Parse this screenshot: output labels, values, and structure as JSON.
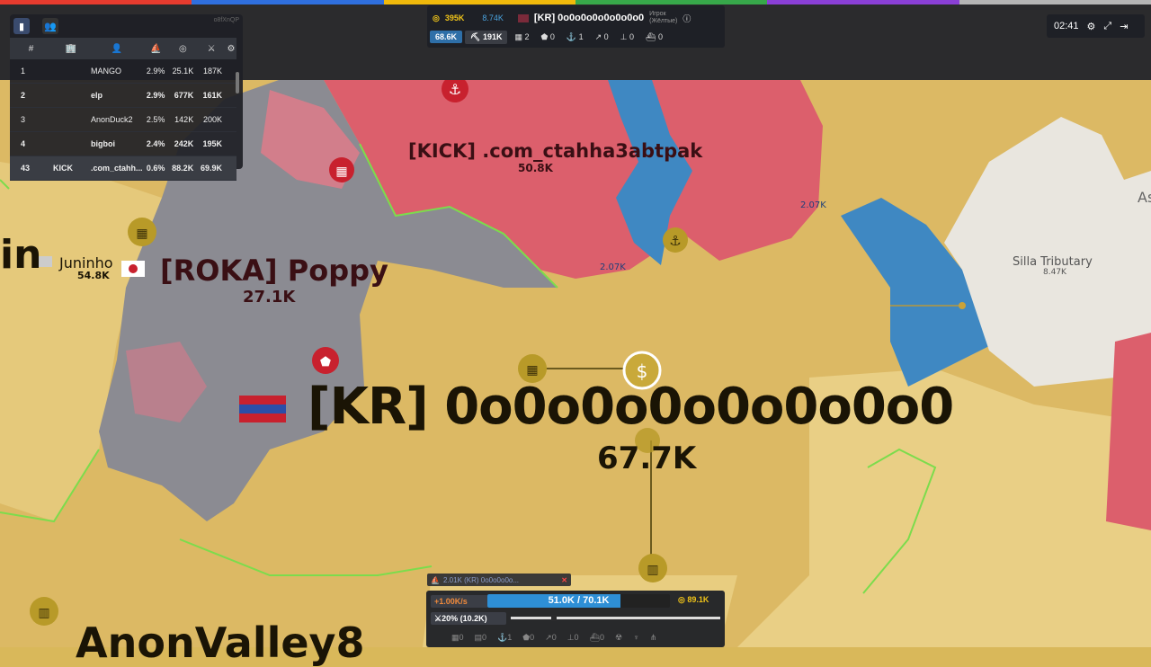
{
  "top_stripe_colors": [
    "#e63b2e",
    "#2f6fde",
    "#f0b90b",
    "#37a84a",
    "#8a3fd6",
    "#b6b6b6"
  ],
  "leaderboard": {
    "id": "o8fXnQP",
    "headers": [
      "#",
      "🏢",
      "👤",
      "⛵",
      "◎",
      "⚔",
      "⚙"
    ],
    "rows": [
      {
        "rank": "1",
        "tag": "",
        "name": "MANGO",
        "pct": "2.9%",
        "gold": "25.1K",
        "troops": "187K",
        "bold": false
      },
      {
        "rank": "2",
        "tag": "",
        "name": "elp",
        "pct": "2.9%",
        "gold": "677K",
        "troops": "161K",
        "bold": true
      },
      {
        "rank": "3",
        "tag": "",
        "name": "AnonDuck2",
        "pct": "2.5%",
        "gold": "142K",
        "troops": "200K",
        "bold": false
      },
      {
        "rank": "4",
        "tag": "",
        "name": "bigboi",
        "pct": "2.4%",
        "gold": "242K",
        "troops": "195K",
        "bold": true
      },
      {
        "rank": "43",
        "tag": "KICK",
        "name": ".com_ctahh...",
        "pct": "0.6%",
        "gold": "88.2K",
        "troops": "69.9K",
        "bold": true
      }
    ]
  },
  "player_panel": {
    "gold": "395K",
    "gold_rate": "8.74K",
    "name": "[KR] 0o0o0o0o0o0o0o0",
    "sub1": "Игрок",
    "sub2": "(Жёлтые)",
    "troops_pill": "68.6K",
    "workers": "191K",
    "stats": [
      {
        "icon": "city-icon",
        "value": "2"
      },
      {
        "icon": "defense-icon",
        "value": "0"
      },
      {
        "icon": "port-icon",
        "value": "1"
      },
      {
        "icon": "missile-icon",
        "value": "0"
      },
      {
        "icon": "sam-icon",
        "value": "0"
      },
      {
        "icon": "warship-icon",
        "value": "0"
      }
    ]
  },
  "clock": "02:41",
  "bottom_panel": {
    "rate": "+1.00K/s",
    "troops_bar": "51.0K / 70.1K",
    "troops_fraction": 0.728,
    "gold": "89.1K",
    "attack_ratio": "20% (10.2K)",
    "build_counts": [
      "0",
      "0",
      "1",
      "0",
      "0",
      "0",
      "0"
    ]
  },
  "notification": "2.01K (KR) 0o0o0o0o...",
  "map_labels": {
    "kick_name": "[KICK] .com_ctahha3abtpak",
    "kick_troops": "50.8K",
    "roka_name": "[ROKA] Poppy",
    "roka_troops": "27.1K",
    "kr_name": "[KR] 0o0o0o0o0o0o0o0",
    "kr_troops": "67.7K",
    "juninho_name": "Juninho",
    "juninho_troops": "54.8K",
    "silla_name": "Silla Tributary",
    "silla_troops": "8.47K",
    "boat1": "2.07K",
    "boat2": "2.07K",
    "left_fragment": "in",
    "right_fragment": "As",
    "bottom_name": "AnonValley8"
  }
}
